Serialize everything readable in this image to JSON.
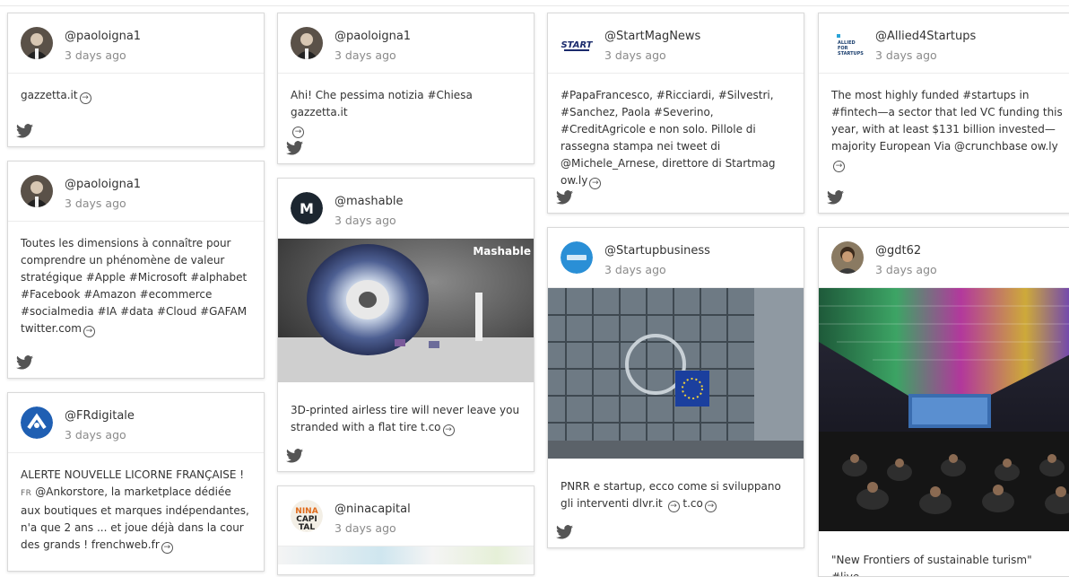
{
  "cards": [
    {
      "handle": "@paoloigna1",
      "time": "3 days ago",
      "text": "gazzetta.it",
      "avatar_icon": "person-avatar"
    },
    {
      "handle": "@paoloigna1",
      "time": "3 days ago",
      "text": "Toutes les dimensions à connaître pour comprendre un phénomène de valeur stratégique #Apple #Microsoft #alphabet #Facebook #Amazon #ecommerce #socialmedia #IA #data #Cloud #GAFAM twitter.com",
      "avatar_icon": "person-avatar"
    },
    {
      "handle": "@FRdigitale",
      "time": "3 days ago",
      "text_before_flag": "ALERTE NOUVELLE LICORNE FRANÇAISE !",
      "flag": "FR",
      "text_after_flag": "@Ankorstore, la marketplace dédiée aux boutiques et marques indépendantes, n'a que 2 ans ... et joue déjà dans la cour des grands ! frenchweb.fr",
      "avatar_icon": "frdigitale-logo"
    },
    {
      "handle": "@paoloigna1",
      "time": "3 days ago",
      "text": "Ahi! Che pessima notizia #Chiesa gazzetta.it",
      "avatar_icon": "person-avatar"
    },
    {
      "handle": "@mashable",
      "time": "3 days ago",
      "text": "3D-printed airless tire will never leave you stranded with a flat tire t.co",
      "image_label": "Mashable",
      "avatar_icon": "mashable-logo"
    },
    {
      "handle": "@ninacapital",
      "time": "3 days ago",
      "avatar_text": "NINA CAPI TAL",
      "avatar_icon": "ninacapital-logo"
    },
    {
      "handle": "@StartMagNews",
      "time": "3 days ago",
      "text": "#PapaFrancesco, #Ricciardi, #Silvestri, #Sanchez, Paola #Severino, #CreditAgricole e non solo. Pillole di rassegna stampa nei tweet di @Michele_Arnese, direttore di Startmag ow.ly",
      "avatar_text": "START",
      "avatar_icon": "startmag-logo"
    },
    {
      "handle": "@Startupbusiness",
      "time": "3 days ago",
      "text": "PNRR e startup, ecco come si sviluppano gli interventi dlvr.it",
      "link2": "t.co",
      "avatar_icon": "startupbusiness-logo"
    },
    {
      "handle": "@Allied4Startups",
      "time": "3 days ago",
      "text": "The most highly funded #startups in #fintech—a sector that led VC funding this year, with at least $131 billion invested—majority European Via @crunchbase ow.ly",
      "avatar_text": "ALLIED FOR STARTUPS",
      "avatar_icon": "allied-logo"
    },
    {
      "handle": "@gdt62",
      "time": "3 days ago",
      "text": "\"New Frontiers of sustainable turism\" #live",
      "avatar_icon": "person-avatar"
    }
  ],
  "colors": {
    "twitter_icon": "#555555",
    "card_border": "#d9d9d9",
    "time": "#8a8a8a"
  }
}
